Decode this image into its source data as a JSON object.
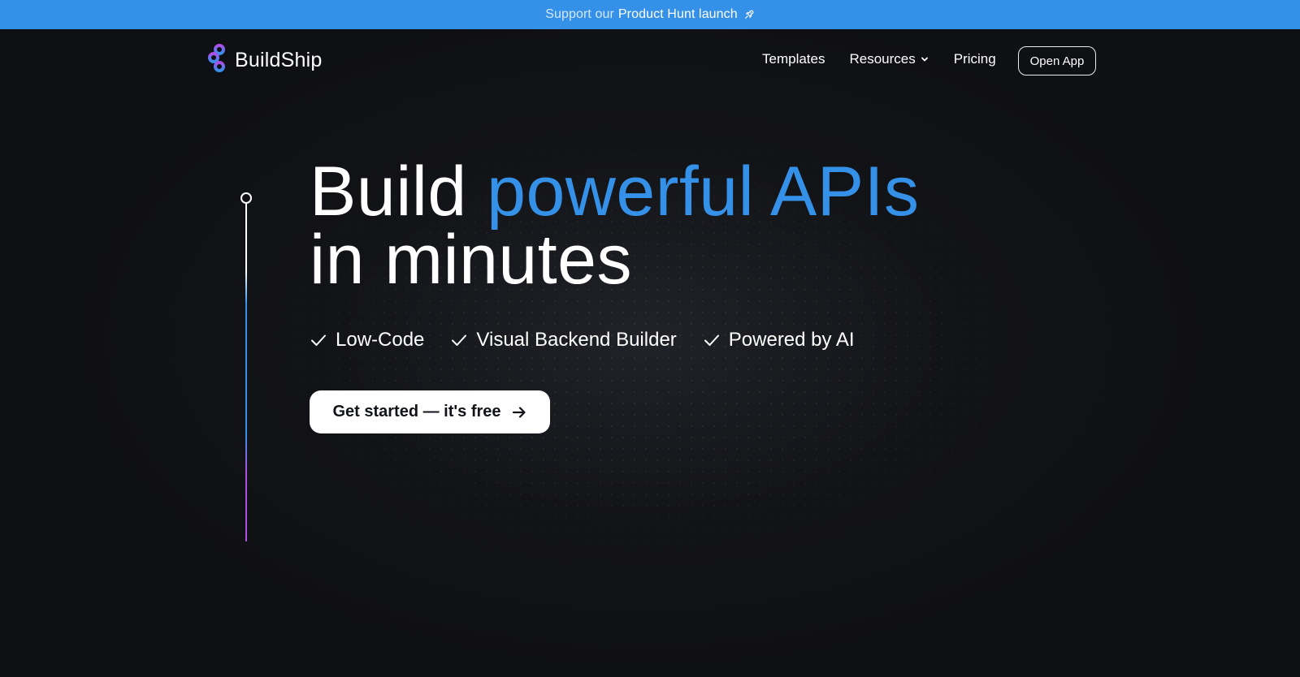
{
  "banner": {
    "prefix": "Support our",
    "link_text": "Product Hunt launch",
    "icon": "rocket-icon",
    "background": "#3591e8"
  },
  "nav": {
    "logo_text": "BuildShip",
    "logo_icon": "buildship-logo",
    "links": [
      {
        "label": "Templates"
      },
      {
        "label": "Resources",
        "icon": "chevron-down-icon"
      },
      {
        "label": "Pricing"
      }
    ],
    "open_app_label": "Open App"
  },
  "hero": {
    "title_word1": "Build",
    "title_accent": "powerful APIs",
    "title_line2": "in minutes",
    "accent_color": "#3591e8",
    "features": [
      {
        "label": "Low-Code",
        "icon": "check-icon"
      },
      {
        "label": "Visual Backend Builder",
        "icon": "check-icon"
      },
      {
        "label": "Powered by AI",
        "icon": "check-icon"
      }
    ],
    "cta_label": "Get started — it's free",
    "cta_icon": "arrow-right-icon"
  },
  "colors": {
    "background": "#0f1013",
    "text": "#ffffff",
    "timeline_gradient": [
      "#ffffff",
      "#3591e8",
      "#b04ee6"
    ]
  }
}
